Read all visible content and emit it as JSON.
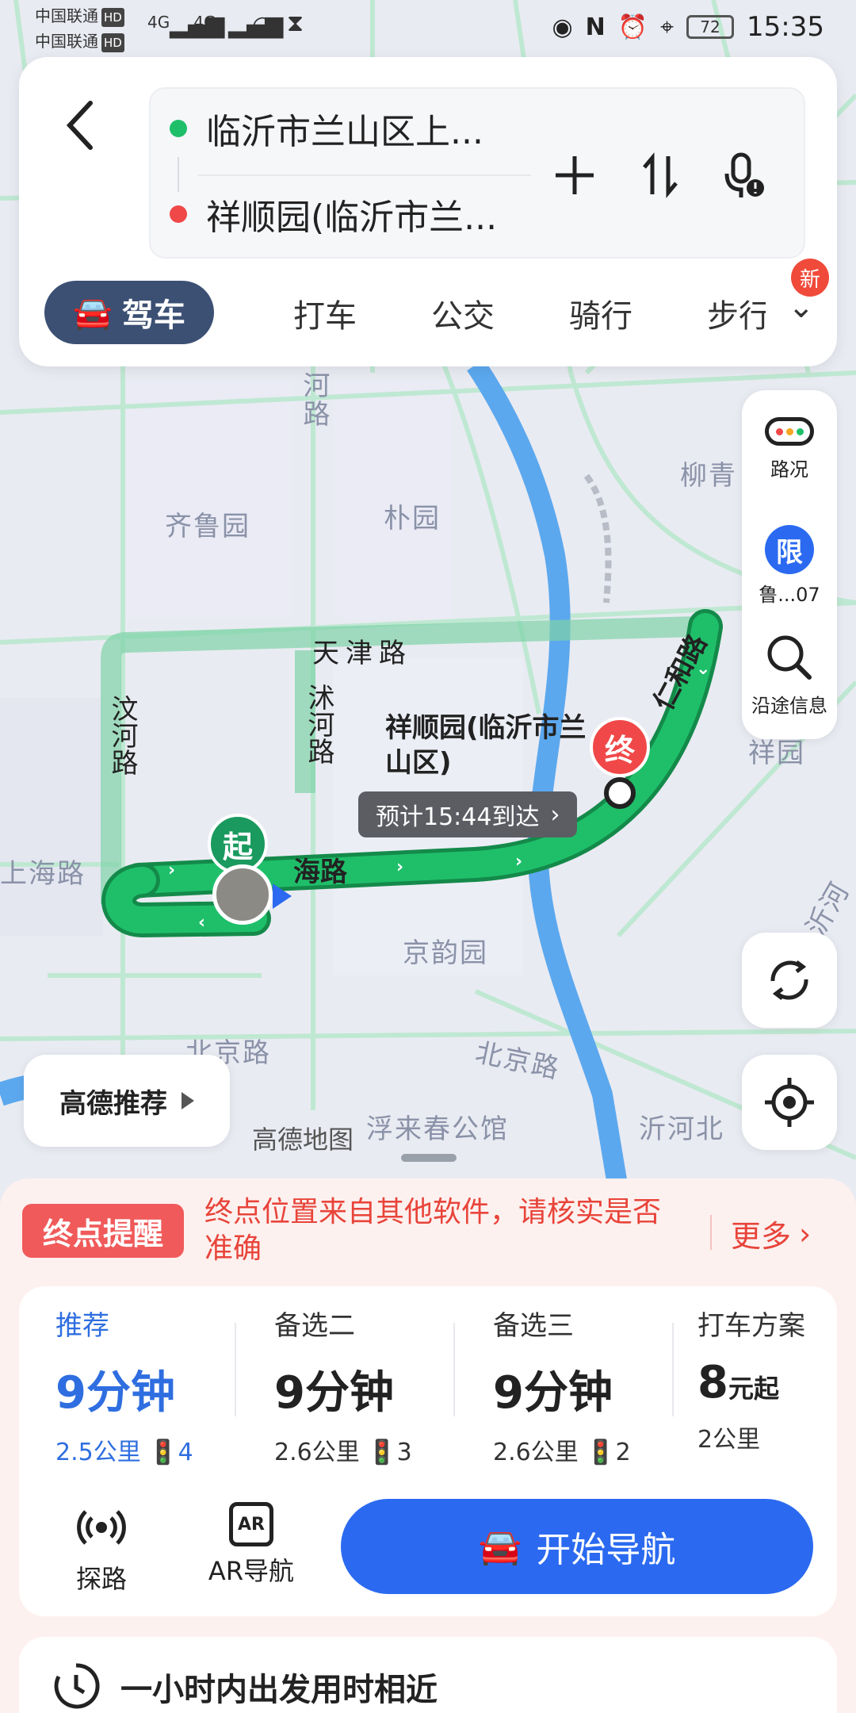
{
  "status_bar": {
    "carrier1": "中国联通",
    "carrier2": "中国联通",
    "hd": "HD",
    "net1": "4G",
    "net2": "4G",
    "battery": "72",
    "time": "15:35"
  },
  "search": {
    "origin": "临沂市兰山区上...",
    "destination": "祥顺园(临沂市兰..."
  },
  "tabs": {
    "items": [
      "驾车",
      "打车",
      "公交",
      "骑行",
      "步行"
    ],
    "active_index": 0,
    "new_badge": "新"
  },
  "map": {
    "labels": {
      "river_road_top": "河路",
      "qilu": "齐鲁园",
      "puyuan": "朴园",
      "liuqing": "柳青",
      "tianjin": "天津路",
      "wenhe": "汶河路",
      "shuhe": "沭河路",
      "shanghai_left": "上海路",
      "shanghai": "海路",
      "renhe": "仁和路",
      "xiangyuan": "祥园",
      "jingyun": "京韵园",
      "beijing1": "北京路",
      "beijing2": "北京路",
      "fulai": "浮来春公馆",
      "yihe": "沂河北",
      "yihe2": "沂河",
      "gaode_map": "高德地图"
    },
    "dest_callout": "祥顺园(临沂市兰山区)",
    "eta": "预计15:44到达",
    "start_marker": "起",
    "end_marker": "终"
  },
  "right_panel": {
    "traffic": "路况",
    "limit_icon": "限",
    "limit_text": "鲁...07",
    "along": "沿途信息"
  },
  "gaode_tip": "高德推荐",
  "alert": {
    "tag": "终点提醒",
    "text": "终点位置来自其他软件，请核实是否准确",
    "more": "更多"
  },
  "plans": [
    {
      "name": "推荐",
      "time": "9分钟",
      "distance": "2.5公里",
      "lights": "4"
    },
    {
      "name": "备选二",
      "time": "9分钟",
      "distance": "2.6公里",
      "lights": "3"
    },
    {
      "name": "备选三",
      "time": "9分钟",
      "distance": "2.6公里",
      "lights": "2"
    }
  ],
  "taxi_plan": {
    "name": "打车方案",
    "price": "8",
    "unit": "元起",
    "distance": "2公里"
  },
  "actions": {
    "explore": "探路",
    "ar": "AR导航",
    "ar_icon": "AR",
    "start": "开始导航"
  },
  "next_card": "一小时内出发用时相近",
  "colors": {
    "route": "#1fbf6a",
    "accent": "#2b6af0",
    "alert": "#e8443a",
    "tab_active": "#3b5073"
  }
}
